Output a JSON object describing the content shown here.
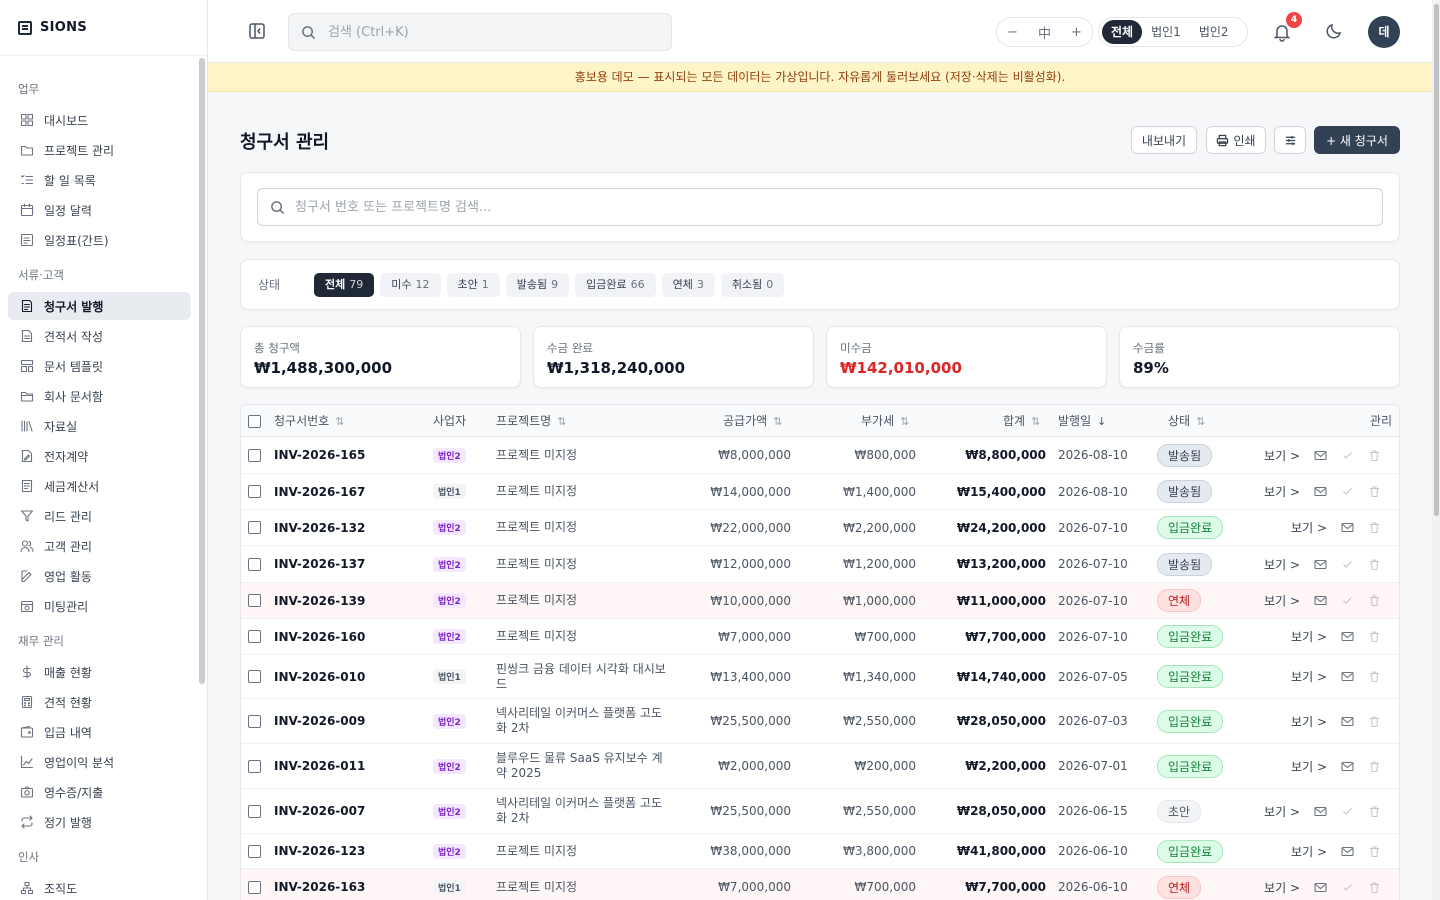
{
  "brand": "SIONS",
  "sidebar": {
    "sections": [
      {
        "title": "업무",
        "items": [
          {
            "label": "대시보드",
            "icon": "grid-icon"
          },
          {
            "label": "프로젝트 관리",
            "icon": "folder-icon"
          },
          {
            "label": "할 일 목록",
            "icon": "list-check-icon"
          },
          {
            "label": "일정 달력",
            "icon": "calendar-icon"
          },
          {
            "label": "일정표(간트)",
            "icon": "gantt-icon"
          }
        ]
      },
      {
        "title": "서류·고객",
        "items": [
          {
            "label": "청구서 발행",
            "icon": "invoice-icon",
            "active": true
          },
          {
            "label": "견적서 작성",
            "icon": "document-icon"
          },
          {
            "label": "문서 템플릿",
            "icon": "template-icon"
          },
          {
            "label": "회사 문서함",
            "icon": "folder-open-icon"
          },
          {
            "label": "자료실",
            "icon": "library-icon"
          },
          {
            "label": "전자계약",
            "icon": "signature-icon"
          },
          {
            "label": "세금계산서",
            "icon": "receipt-icon"
          },
          {
            "label": "리드 관리",
            "icon": "funnel-icon"
          },
          {
            "label": "고객 관리",
            "icon": "users-icon"
          },
          {
            "label": "영업 활동",
            "icon": "edit-icon"
          },
          {
            "label": "미팅관리",
            "icon": "calendar-clock-icon"
          }
        ]
      },
      {
        "title": "재무 관리",
        "items": [
          {
            "label": "매출 현황",
            "icon": "dollar-icon"
          },
          {
            "label": "견적 현황",
            "icon": "calculator-icon"
          },
          {
            "label": "입금 내역",
            "icon": "wallet-icon"
          },
          {
            "label": "영업이익 분석",
            "icon": "chart-line-icon"
          },
          {
            "label": "영수증/지출",
            "icon": "camera-icon"
          },
          {
            "label": "정기 발행",
            "icon": "repeat-icon"
          }
        ]
      },
      {
        "title": "인사",
        "items": [
          {
            "label": "조직도",
            "icon": "org-chart-icon"
          }
        ]
      }
    ]
  },
  "topbar": {
    "search_placeholder": "검색 (Ctrl+K)",
    "font_size": {
      "minus": "−",
      "value": "中",
      "plus": "+"
    },
    "entities": [
      "전체",
      "법인1",
      "법인2"
    ],
    "entity_selected": "전체",
    "notifications": "4",
    "avatar": "데"
  },
  "banner": "홍보용 데모 — 표시되는 모든 데이터는 가상입니다. 자유롭게 둘러보세요 (저장·삭제는 비활성화).",
  "page": {
    "title": "청구서 관리",
    "buttons": {
      "export": "내보내기",
      "print": "인쇄",
      "new": "+ 새 청구서"
    }
  },
  "filter": {
    "search_placeholder": "청구서 번호 또는 프로젝트명 검색..."
  },
  "status_filter": {
    "label": "상태",
    "chips": [
      {
        "label": "전체",
        "count": "79",
        "active": true
      },
      {
        "label": "미수",
        "count": "12"
      },
      {
        "label": "초안",
        "count": "1"
      },
      {
        "label": "발송됨",
        "count": "9"
      },
      {
        "label": "입금완료",
        "count": "66"
      },
      {
        "label": "연체",
        "count": "3"
      },
      {
        "label": "취소됨",
        "count": "0"
      }
    ]
  },
  "stats": [
    {
      "label": "총 청구액",
      "value": "₩1,488,300,000"
    },
    {
      "label": "수금 완료",
      "value": "₩1,318,240,000"
    },
    {
      "label": "미수금",
      "value": "₩142,010,000",
      "highlight": true
    },
    {
      "label": "수금률",
      "value": "89%"
    }
  ],
  "table": {
    "headers": {
      "invoice": "청구서번호",
      "entity": "사업자",
      "project": "프로젝트명",
      "supply": "공급가액",
      "vat": "부가세",
      "total": "합계",
      "date": "발행일",
      "status": "상태",
      "actions": "관리"
    },
    "view_label": "보기 >",
    "rows": [
      {
        "invoice": "INV-2026-165",
        "entity": "법인2",
        "project": "프로젝트 미지정",
        "supply": "₩8,000,000",
        "vat": "₩800,000",
        "total": "₩8,800,000",
        "date": "2026-08-10",
        "status": "발송됨",
        "status_type": "sent"
      },
      {
        "invoice": "INV-2026-167",
        "entity": "법인1",
        "project": "프로젝트 미지정",
        "supply": "₩14,000,000",
        "vat": "₩1,400,000",
        "total": "₩15,400,000",
        "date": "2026-08-10",
        "status": "발송됨",
        "status_type": "sent"
      },
      {
        "invoice": "INV-2026-132",
        "entity": "법인2",
        "project": "프로젝트 미지정",
        "supply": "₩22,000,000",
        "vat": "₩2,200,000",
        "total": "₩24,200,000",
        "date": "2026-07-10",
        "status": "입금완료",
        "status_type": "paid"
      },
      {
        "invoice": "INV-2026-137",
        "entity": "법인2",
        "project": "프로젝트 미지정",
        "supply": "₩12,000,000",
        "vat": "₩1,200,000",
        "total": "₩13,200,000",
        "date": "2026-07-10",
        "status": "발송됨",
        "status_type": "sent"
      },
      {
        "invoice": "INV-2026-139",
        "entity": "법인2",
        "project": "프로젝트 미지정",
        "supply": "₩10,000,000",
        "vat": "₩1,000,000",
        "total": "₩11,000,000",
        "date": "2026-07-10",
        "status": "연체",
        "status_type": "overdue"
      },
      {
        "invoice": "INV-2026-160",
        "entity": "법인2",
        "project": "프로젝트 미지정",
        "supply": "₩7,000,000",
        "vat": "₩700,000",
        "total": "₩7,700,000",
        "date": "2026-07-10",
        "status": "입금완료",
        "status_type": "paid"
      },
      {
        "invoice": "INV-2026-010",
        "entity": "법인1",
        "project": "핀씽크 금융 데이터 시각화 대시보드",
        "supply": "₩13,400,000",
        "vat": "₩1,340,000",
        "total": "₩14,740,000",
        "date": "2026-07-05",
        "status": "입금완료",
        "status_type": "paid"
      },
      {
        "invoice": "INV-2026-009",
        "entity": "법인2",
        "project": "넥사리테일 이커머스 플랫폼 고도화 2차",
        "supply": "₩25,500,000",
        "vat": "₩2,550,000",
        "total": "₩28,050,000",
        "date": "2026-07-03",
        "status": "입금완료",
        "status_type": "paid"
      },
      {
        "invoice": "INV-2026-011",
        "entity": "법인2",
        "project": "블루우드 물류 SaaS 유지보수 계약 2025",
        "supply": "₩2,000,000",
        "vat": "₩200,000",
        "total": "₩2,200,000",
        "date": "2026-07-01",
        "status": "입금완료",
        "status_type": "paid"
      },
      {
        "invoice": "INV-2026-007",
        "entity": "법인2",
        "project": "넥사리테일 이커머스 플랫폼 고도화 2차",
        "supply": "₩25,500,000",
        "vat": "₩2,550,000",
        "total": "₩28,050,000",
        "date": "2026-06-15",
        "status": "초안",
        "status_type": "draft"
      },
      {
        "invoice": "INV-2026-123",
        "entity": "법인2",
        "project": "프로젝트 미지정",
        "supply": "₩38,000,000",
        "vat": "₩3,800,000",
        "total": "₩41,800,000",
        "date": "2026-06-10",
        "status": "입금완료",
        "status_type": "paid"
      },
      {
        "invoice": "INV-2026-163",
        "entity": "법인1",
        "project": "프로젝트 미지정",
        "supply": "₩7,000,000",
        "vat": "₩700,000",
        "total": "₩7,700,000",
        "date": "2026-06-10",
        "status": "연체",
        "status_type": "overdue"
      }
    ]
  },
  "colors": {
    "accent": "#334155",
    "overdue": "#dc2626",
    "paid": "#15803d",
    "banner": "#fdf4c8"
  }
}
